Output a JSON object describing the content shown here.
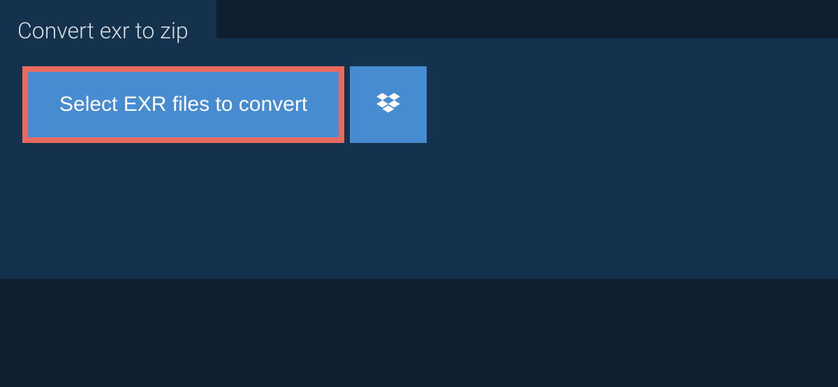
{
  "tab": {
    "title": "Convert exr to zip"
  },
  "buttons": {
    "select_label": "Select EXR files to convert"
  }
}
